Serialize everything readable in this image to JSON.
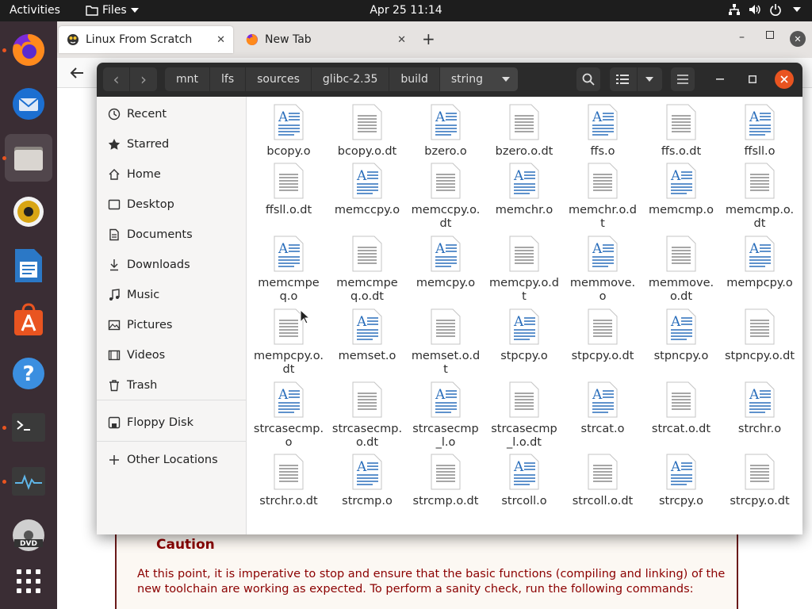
{
  "topbar": {
    "activities": "Activities",
    "app_menu": "Files",
    "clock": "Apr 25  11:14"
  },
  "browser": {
    "tabs": [
      {
        "label": "Linux From Scratch",
        "active": true
      },
      {
        "label": "New Tab",
        "active": false
      }
    ],
    "caution_title": "Caution",
    "caution_text": "At this point, it is imperative to stop and ensure that the basic functions (compiling and linking) of the new toolchain are working as expected. To perform a sanity check, run the following commands:"
  },
  "files": {
    "path": [
      "mnt",
      "lfs",
      "sources",
      "glibc-2.35",
      "build",
      "string"
    ],
    "sidebar": [
      {
        "label": "Recent",
        "icon": "clock-icon"
      },
      {
        "label": "Starred",
        "icon": "star-icon"
      },
      {
        "label": "Home",
        "icon": "home-icon"
      },
      {
        "label": "Desktop",
        "icon": "desktop-icon"
      },
      {
        "label": "Documents",
        "icon": "document-icon"
      },
      {
        "label": "Downloads",
        "icon": "download-icon"
      },
      {
        "label": "Music",
        "icon": "music-icon"
      },
      {
        "label": "Pictures",
        "icon": "picture-icon"
      },
      {
        "label": "Videos",
        "icon": "video-icon"
      },
      {
        "label": "Trash",
        "icon": "trash-icon"
      },
      {
        "label": "Floppy Disk",
        "icon": "floppy-icon"
      },
      {
        "label": "Other Locations",
        "icon": "plus-icon"
      }
    ],
    "items": [
      {
        "name": "bcopy.o",
        "type": "object"
      },
      {
        "name": "bcopy.o.dt",
        "type": "text"
      },
      {
        "name": "bzero.o",
        "type": "object"
      },
      {
        "name": "bzero.o.dt",
        "type": "text"
      },
      {
        "name": "ffs.o",
        "type": "object"
      },
      {
        "name": "ffs.o.dt",
        "type": "text"
      },
      {
        "name": "ffsll.o",
        "type": "object"
      },
      {
        "name": "ffsll.o.dt",
        "type": "text"
      },
      {
        "name": "memccpy.o",
        "type": "object"
      },
      {
        "name": "memccpy.o.dt",
        "type": "text"
      },
      {
        "name": "memchr.o",
        "type": "object"
      },
      {
        "name": "memchr.o.dt",
        "type": "text"
      },
      {
        "name": "memcmp.o",
        "type": "object"
      },
      {
        "name": "memcmp.o.dt",
        "type": "text"
      },
      {
        "name": "memcmpeq.o",
        "type": "object"
      },
      {
        "name": "memcmpeq.o.dt",
        "type": "text"
      },
      {
        "name": "memcpy.o",
        "type": "object"
      },
      {
        "name": "memcpy.o.dt",
        "type": "text"
      },
      {
        "name": "memmove.o",
        "type": "object"
      },
      {
        "name": "memmove.o.dt",
        "type": "text"
      },
      {
        "name": "mempcpy.o",
        "type": "object"
      },
      {
        "name": "mempcpy.o.dt",
        "type": "text"
      },
      {
        "name": "memset.o",
        "type": "object"
      },
      {
        "name": "memset.o.dt",
        "type": "text"
      },
      {
        "name": "stpcpy.o",
        "type": "object"
      },
      {
        "name": "stpcpy.o.dt",
        "type": "text"
      },
      {
        "name": "stpncpy.o",
        "type": "object"
      },
      {
        "name": "stpncpy.o.dt",
        "type": "text"
      },
      {
        "name": "strcasecmp.o",
        "type": "object"
      },
      {
        "name": "strcasecmp.o.dt",
        "type": "text"
      },
      {
        "name": "strcasecmp_l.o",
        "type": "object"
      },
      {
        "name": "strcasecmp_l.o.dt",
        "type": "text"
      },
      {
        "name": "strcat.o",
        "type": "object"
      },
      {
        "name": "strcat.o.dt",
        "type": "text"
      },
      {
        "name": "strchr.o",
        "type": "object"
      },
      {
        "name": "strchr.o.dt",
        "type": "text"
      },
      {
        "name": "strcmp.o",
        "type": "object"
      },
      {
        "name": "strcmp.o.dt",
        "type": "text"
      },
      {
        "name": "strcoll.o",
        "type": "object"
      },
      {
        "name": "strcoll.o.dt",
        "type": "text"
      },
      {
        "name": "strcpy.o",
        "type": "object"
      },
      {
        "name": "strcpy.o.dt",
        "type": "text"
      }
    ]
  },
  "dock": [
    {
      "name": "firefox-icon",
      "running": true
    },
    {
      "name": "thunderbird-icon",
      "running": false
    },
    {
      "name": "files-icon",
      "running": true,
      "active": true
    },
    {
      "name": "rhythmbox-icon",
      "running": false
    },
    {
      "name": "writer-icon",
      "running": false
    },
    {
      "name": "software-icon",
      "running": false
    },
    {
      "name": "help-icon",
      "running": false
    },
    {
      "name": "terminal-icon",
      "running": true
    },
    {
      "name": "system-monitor-icon",
      "running": true
    },
    {
      "name": "dvd-icon",
      "running": false
    },
    {
      "name": "app-grid-icon",
      "running": false
    }
  ],
  "colors": {
    "accent": "#e95420",
    "object_icon_blue": "#2a6ebb",
    "caution_red": "#8b0000"
  }
}
